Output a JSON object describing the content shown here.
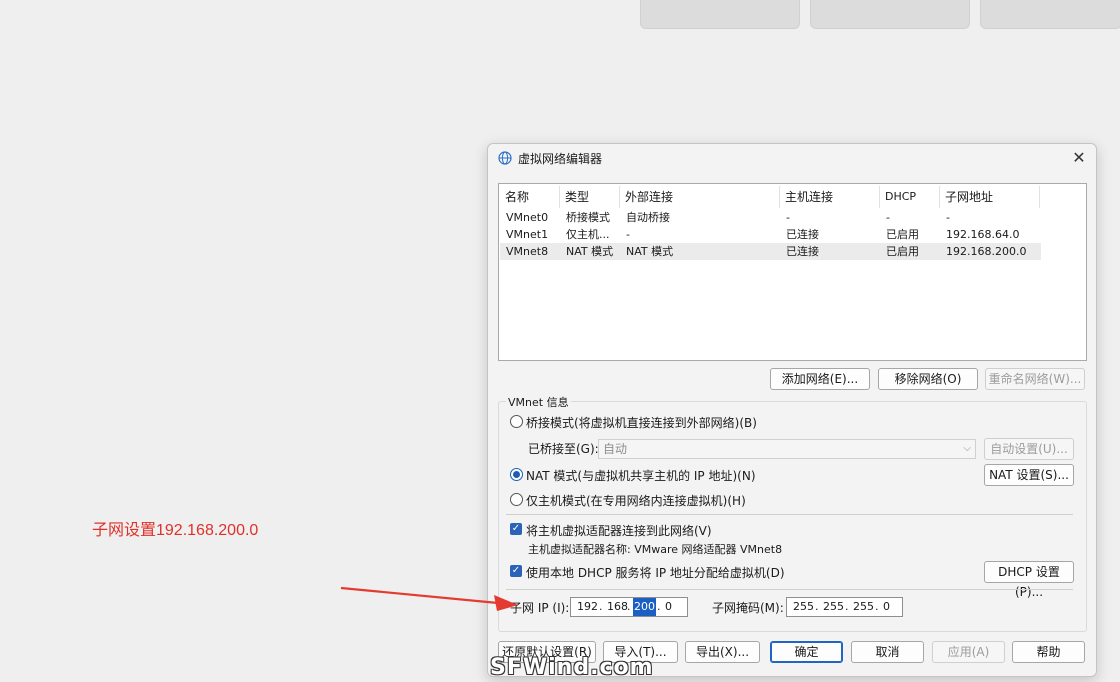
{
  "annotation": {
    "text": "子网设置192.168.200.0",
    "color": "#e0302a"
  },
  "window": {
    "title": "虚拟网络编辑器"
  },
  "table": {
    "columns": [
      "名称",
      "类型",
      "外部连接",
      "主机连接",
      "DHCP",
      "子网地址"
    ],
    "rows": [
      [
        "VMnet0",
        "桥接模式",
        "自动桥接",
        "-",
        "-",
        "-"
      ],
      [
        "VMnet1",
        "仅主机...",
        "-",
        "已连接",
        "已启用",
        "192.168.64.0"
      ],
      [
        "VMnet8",
        "NAT 模式",
        "NAT 模式",
        "已连接",
        "已启用",
        "192.168.200.0"
      ]
    ]
  },
  "table_buttons": {
    "add": "添加网络(E)...",
    "remove": "移除网络(O)",
    "rename": "重命名网络(W)..."
  },
  "vmnet_info": {
    "label": "VMnet 信息",
    "bridge_mode": "桥接模式(将虚拟机直接连接到外部网络)(B)",
    "bridged_to_label": "已桥接至(G):",
    "bridged_to_value": "自动",
    "auto_settings": "自动设置(U)...",
    "nat_mode": "NAT 模式(与虚拟机共享主机的 IP 地址)(N)",
    "nat_settings": "NAT 设置(S)...",
    "host_only_mode": "仅主机模式(在专用网络内连接虚拟机)(H)",
    "connect_adapter": "将主机虚拟适配器连接到此网络(V)",
    "adapter_name": "主机虚拟适配器名称: VMware 网络适配器 VMnet8",
    "use_dhcp": "使用本地 DHCP 服务将 IP 地址分配给虚拟机(D)",
    "dhcp_settings": "DHCP 设置(P)...",
    "subnet_ip_label": "子网 IP (I):",
    "subnet_ip": [
      "192",
      "168",
      "200",
      "0"
    ],
    "subnet_mask_label": "子网掩码(M):",
    "subnet_mask": [
      "255",
      "255",
      "255",
      "0"
    ]
  },
  "footer": {
    "restore": "还原默认设置(R)",
    "import": "导入(T)...",
    "export": "导出(X)...",
    "ok": "确定",
    "cancel": "取消",
    "apply": "应用(A)",
    "help": "帮助"
  },
  "watermark": "SFWind.com"
}
